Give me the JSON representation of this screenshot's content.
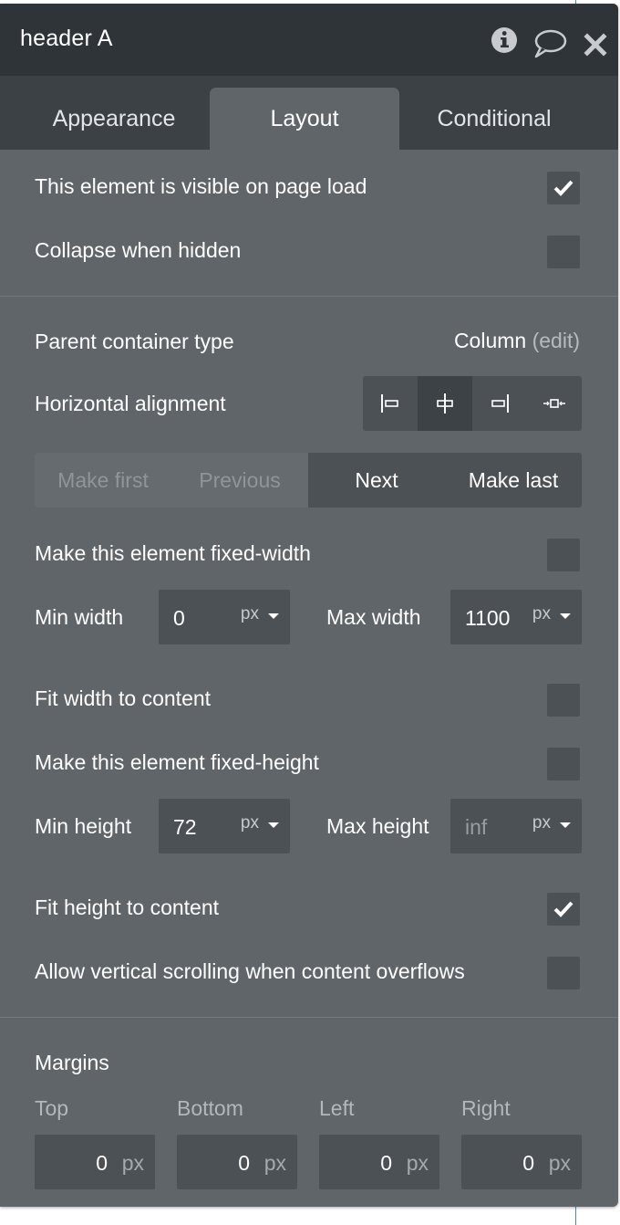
{
  "header": {
    "title": "header A",
    "icons": [
      "info-circle-icon",
      "speech-bubble-icon",
      "close-icon"
    ]
  },
  "tabs": [
    {
      "label": "Appearance",
      "active": false
    },
    {
      "label": "Layout",
      "active": true
    },
    {
      "label": "Conditional",
      "active": false
    }
  ],
  "visibility": {
    "visible_on_load": {
      "label": "This element is visible on page load",
      "checked": true
    },
    "collapse_hidden": {
      "label": "Collapse when hidden",
      "checked": false
    }
  },
  "parent": {
    "label": "Parent container type",
    "value": "Column",
    "edit": "(edit)"
  },
  "alignment": {
    "label": "Horizontal alignment",
    "options": [
      "align-left-icon",
      "align-center-icon",
      "align-right-icon",
      "align-distribute-icon"
    ],
    "selected": "align-center-icon"
  },
  "ordering": {
    "make_first": "Make first",
    "previous": "Previous",
    "next": "Next",
    "make_last": "Make last"
  },
  "width": {
    "fixed": {
      "label": "Make this element fixed-width",
      "checked": false
    },
    "min_label": "Min width",
    "min_value": "0",
    "min_unit": "px",
    "max_label": "Max width",
    "max_value": "1100",
    "max_unit": "px",
    "fit": {
      "label": "Fit width to content",
      "checked": false
    }
  },
  "height": {
    "fixed": {
      "label": "Make this element fixed-height",
      "checked": false
    },
    "min_label": "Min height",
    "min_value": "72",
    "min_unit": "px",
    "max_label": "Max height",
    "max_placeholder": "inf",
    "max_unit": "px",
    "fit": {
      "label": "Fit height to content",
      "checked": true
    },
    "scroll": {
      "label": "Allow vertical scrolling when content overflows",
      "checked": false
    }
  },
  "margins": {
    "title": "Margins",
    "top": {
      "label": "Top",
      "value": "0",
      "unit": "px"
    },
    "bottom": {
      "label": "Bottom",
      "value": "0",
      "unit": "px"
    },
    "left": {
      "label": "Left",
      "value": "0",
      "unit": "px"
    },
    "right": {
      "label": "Right",
      "value": "0",
      "unit": "px"
    }
  },
  "colors": {
    "panel": "#5f6569",
    "header": "#2e3438",
    "tabbar": "#3b4145",
    "input": "#4b5155",
    "guide_line": "#4d86c9"
  }
}
